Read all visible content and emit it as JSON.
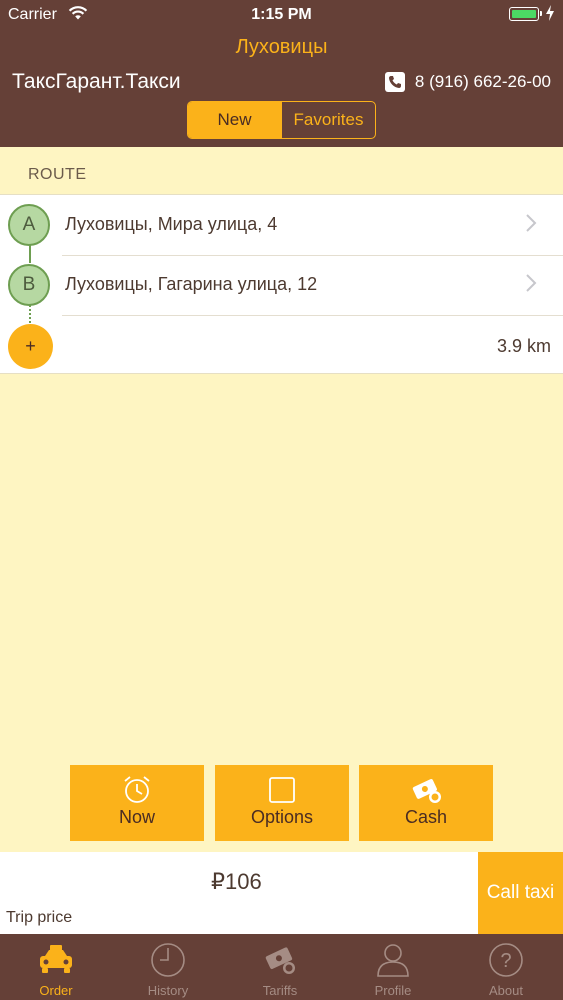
{
  "status_bar": {
    "carrier": "Carrier",
    "time": "1:15 PM"
  },
  "header": {
    "city": "Луховицы",
    "brand": "ТаксГарант.Такси",
    "phone": "8 (916) 662-26-00",
    "tabs": [
      {
        "label": "New",
        "selected": true
      },
      {
        "label": "Favorites",
        "selected": false
      }
    ]
  },
  "route": {
    "label": "ROUTE",
    "stops": [
      {
        "marker": "A",
        "address": "Луховицы, Мира улица, 4"
      },
      {
        "marker": "B",
        "address": "Луховицы, Гагарина улица, 12"
      }
    ],
    "add_label": "+",
    "distance": "3.9 km"
  },
  "options": [
    {
      "label": "Now",
      "icon": "alarm-clock-icon"
    },
    {
      "label": "Options",
      "icon": "square-icon"
    },
    {
      "label": "Cash",
      "icon": "cash-icon"
    }
  ],
  "price": {
    "value": "₽106",
    "label": "Trip price"
  },
  "call_button": "Call taxi",
  "tab_bar": [
    {
      "label": "Order",
      "icon": "taxi-icon",
      "active": true
    },
    {
      "label": "History",
      "icon": "clock-icon",
      "active": false
    },
    {
      "label": "Tariffs",
      "icon": "money-icon",
      "active": false
    },
    {
      "label": "Profile",
      "icon": "person-icon",
      "active": false
    },
    {
      "label": "About",
      "icon": "question-icon",
      "active": false
    }
  ],
  "colors": {
    "accent": "#fbb21a",
    "header_bg": "#654037",
    "page_bg": "#fef5c2",
    "marker_green": "#b6d8a2"
  }
}
